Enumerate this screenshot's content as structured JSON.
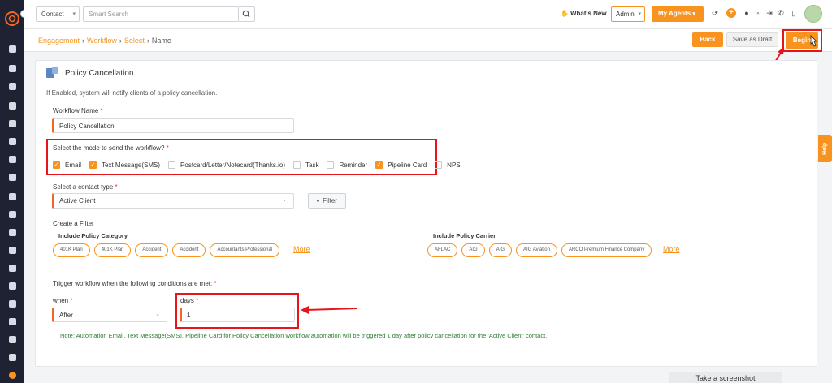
{
  "topbar": {
    "contact_select": "Contact",
    "search_placeholder": "Smart Search",
    "whats_new": "What's New",
    "admin_select": "Admin",
    "my_agents": "My Agents"
  },
  "breadcrumb": {
    "items": [
      "Engagement",
      "Workflow",
      "Select"
    ],
    "current": "Name"
  },
  "actions": {
    "back": "Back",
    "save_draft": "Save as Draft",
    "begin": "Begin"
  },
  "section": {
    "title": "Policy Cancellation",
    "description": "If Enabled, system will notify clients of a policy cancellation."
  },
  "form": {
    "workflow_name_label": "Workflow Name",
    "workflow_name_value": "Policy Cancellation",
    "mode_label": "Select the mode to send the workflow?",
    "modes": [
      {
        "label": "Email",
        "checked": true
      },
      {
        "label": "Text Message(SMS)",
        "checked": true
      },
      {
        "label": "Postcard/Letter/Notecard(Thanks.io)",
        "checked": false
      },
      {
        "label": "Task",
        "checked": false
      },
      {
        "label": "Reminder",
        "checked": false
      },
      {
        "label": "Pipeline Card",
        "checked": true
      },
      {
        "label": "NPS",
        "checked": false
      }
    ],
    "contact_type_label": "Select a contact type",
    "contact_type_value": "Active Client",
    "filter_button": "Filter",
    "create_filter_label": "Create a Filter",
    "policy_category_label": "Include Policy Category",
    "policy_categories": [
      "401K Plan",
      "401K Plan",
      "Accident",
      "Accident",
      "Accountants Professional"
    ],
    "policy_carrier_label": "Include Policy Carrier",
    "policy_carriers": [
      "AFLAC",
      "AIG",
      "AIG",
      "AIG Aviation",
      "ARCO Premium Finance Company"
    ],
    "more_label": "More",
    "trigger_label": "Trigger workflow when the following conditions are met:",
    "when_label": "when",
    "when_value": "After",
    "days_label": "days",
    "days_value": "1",
    "note": "Note: Automation Email, Text Message(SMS), Pipeline Card for Policy Cancellation workflow automation will be triggered 1 day after policy cancellation for the 'Active Client' contact."
  },
  "help_tab": "Help",
  "screenshot_tab": "Take a screenshot",
  "colors": {
    "accent": "#f7931e",
    "highlight": "#e8141b",
    "sidebar": "#1f2233",
    "note": "#2f7d32"
  }
}
